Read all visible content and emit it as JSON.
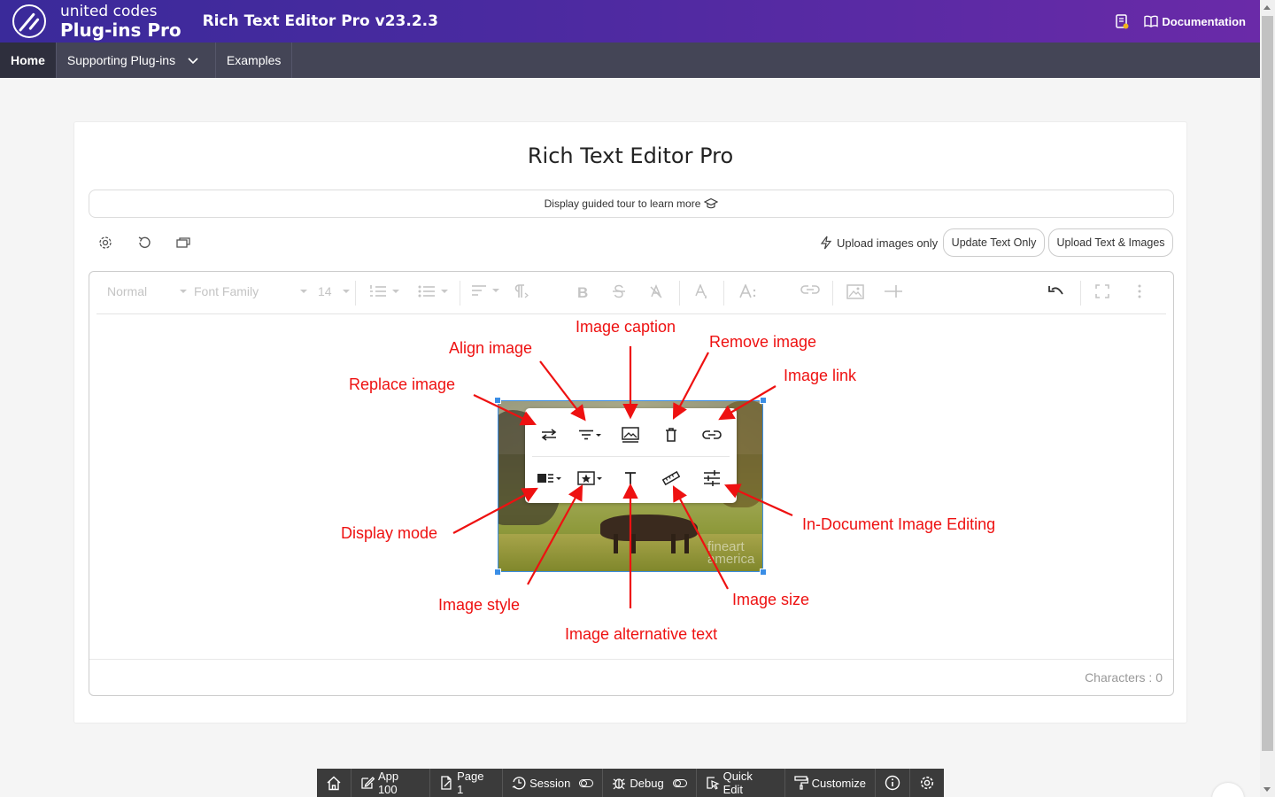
{
  "header": {
    "logo_top": "united codes",
    "logo_bottom": "Plug-ins Pro",
    "app_title": "Rich Text Editor Pro v23.2.3",
    "documentation": "Documentation"
  },
  "nav": {
    "items": [
      {
        "label": "Home"
      },
      {
        "label": "Supporting Plug-ins"
      },
      {
        "label": "Examples"
      }
    ]
  },
  "card": {
    "title": "Rich Text Editor Pro",
    "tour_text": "Display guided tour to learn more",
    "upload_images_only": "Upload images only",
    "update_text_only": "Update Text Only",
    "upload_text_images": "Upload Text & Images"
  },
  "editor": {
    "block_style": "Normal",
    "font_family": "Font Family",
    "font_size": "14",
    "characters": "Characters : 0"
  },
  "image": {
    "watermark_line1": "fineart",
    "watermark_line2": "america"
  },
  "annotations": {
    "replace_image": "Replace image",
    "align_image": "Align image",
    "image_caption": "Image caption",
    "remove_image": "Remove image",
    "image_link": "Image link",
    "display_mode": "Display mode",
    "in_document_editing": "In-Document Image Editing",
    "image_style": "Image style",
    "image_size": "Image size",
    "image_alt_text": "Image alternative text",
    "color": "#ee1111"
  },
  "devbar": {
    "app": "App 100",
    "page": "Page 1",
    "session": "Session",
    "debug": "Debug",
    "quick_edit": "Quick Edit",
    "customize": "Customize"
  }
}
